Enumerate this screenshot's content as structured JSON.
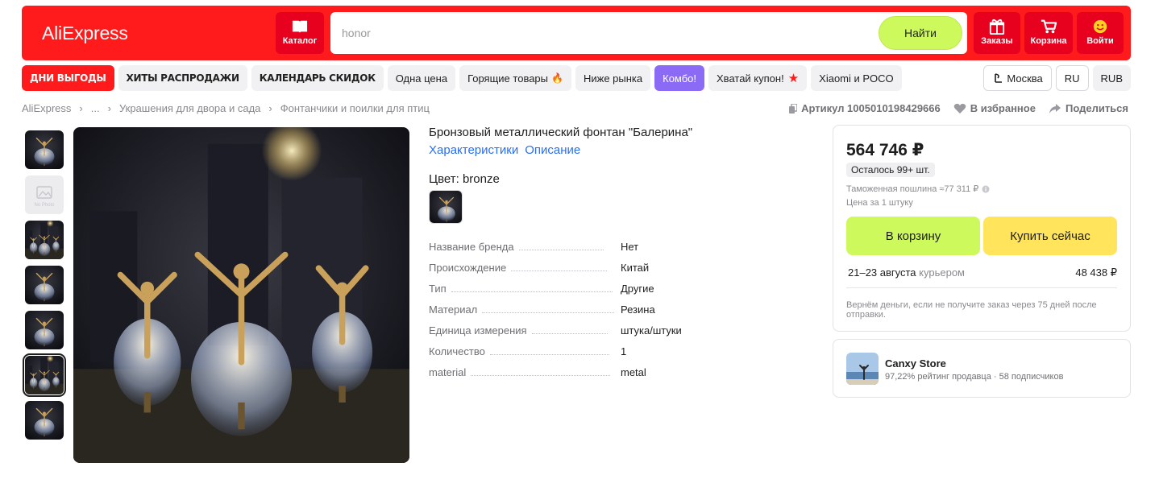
{
  "header": {
    "logo": "AliExpress",
    "catalog_label": "Каталог",
    "search": {
      "value": "honor",
      "button": "Найти"
    },
    "orders_label": "Заказы",
    "cart_label": "Корзина",
    "login_label": "Войти",
    "brand_color": "#ff1b1b"
  },
  "nav": {
    "chips": [
      "ДНИ ВЫГОДЫ",
      "ХИТЫ РАСПРОДАЖИ",
      "КАЛЕНДАРЬ СКИДОК",
      "Одна цена",
      "Горящие товары",
      "Ниже рынка",
      "Комбо!",
      "Хватай купон!",
      "Xiaomi и POCO"
    ],
    "fire_icon": "🔥",
    "star_icon": "★",
    "city": "Москва",
    "lang": "RU",
    "currency": "RUB"
  },
  "breadcrumb": {
    "items": [
      "AliExpress",
      "...",
      "Украшения для двора и сада",
      "Фонтанчики и поилки для птиц"
    ]
  },
  "meta": {
    "article": "Артикул 1005010198429666",
    "favorite": "В избранное",
    "share": "Поделиться"
  },
  "thumbnails": {
    "no_photo": "No Photo"
  },
  "product": {
    "title": "Бронзовый металлический фонтан \"Балерина\"",
    "tabs": [
      "Характеристики",
      "Описание"
    ],
    "color_label": "Цвет: bronze",
    "specs": [
      {
        "k": "Название бренда",
        "v": "Нет"
      },
      {
        "k": "Происхождение",
        "v": "Китай"
      },
      {
        "k": "Тип",
        "v": "Другие"
      },
      {
        "k": "Материал",
        "v": "Резина"
      },
      {
        "k": "Единица измерения",
        "v": "штука/штуки"
      },
      {
        "k": "Количество",
        "v": "1"
      },
      {
        "k": "material",
        "v": "metal"
      }
    ]
  },
  "buy": {
    "price": "564 746 ₽",
    "stock": "Осталось 99+ шт.",
    "duty": "Таможенная пошлина ≈77 311 ₽",
    "per_unit": "Цена за 1 штуку",
    "add_to_cart": "В корзину",
    "buy_now": "Купить сейчас",
    "delivery_date": "21–23 августа",
    "delivery_method": "курьером",
    "delivery_price": "48 438 ₽",
    "refund": "Вернём деньги, если не получите заказ через 75 дней после отправки."
  },
  "store": {
    "name": "Canxy Store",
    "rating": "97,22% рейтинг продавца",
    "subs": "58 подписчиков"
  }
}
